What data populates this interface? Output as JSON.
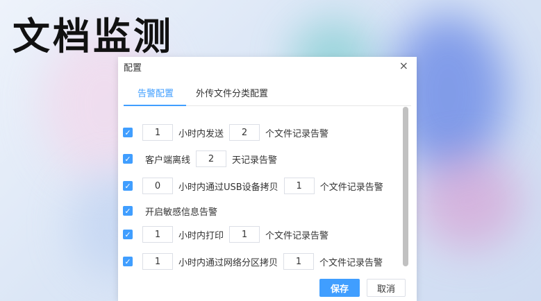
{
  "page_title": "文档监测",
  "dialog": {
    "title": "配置",
    "close_glyph": "×",
    "tabs": [
      {
        "label": "告警配置",
        "active": true
      },
      {
        "label": "外传文件分类配置",
        "active": false
      }
    ],
    "rules": [
      {
        "checked": true,
        "value1": "1",
        "text1": "小时内发送",
        "value2": "2",
        "text2": "个文件记录告警"
      },
      {
        "checked": true,
        "text1": "客户端离线",
        "value1": "2",
        "text2": "天记录告警"
      },
      {
        "checked": true,
        "value1": "0",
        "text1": "小时内通过USB设备拷贝",
        "value2": "1",
        "text2": "个文件记录告警"
      },
      {
        "checked": true,
        "text1": "开启敏感信息告警"
      },
      {
        "checked": true,
        "value1": "1",
        "text1": "小时内打印",
        "value2": "1",
        "text2": "个文件记录告警"
      },
      {
        "checked": true,
        "value1": "1",
        "text1": "小时内通过网络分区拷贝",
        "value2": "1",
        "text2": "个文件记录告警"
      }
    ],
    "save_label": "保存",
    "cancel_label": "取消"
  },
  "colors": {
    "accent": "#409eff"
  }
}
